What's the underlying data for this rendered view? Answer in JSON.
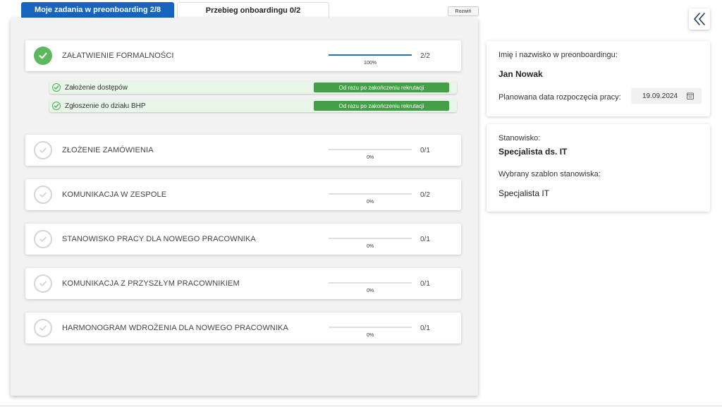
{
  "tabs": [
    {
      "label": "Moje zadania w preonboarding 2/8",
      "active": true
    },
    {
      "label": "Przebieg onboardingu 0/2",
      "active": false
    }
  ],
  "expand_label": "Rozwiń",
  "stages": [
    {
      "title": "ZAŁATWIENIE FORMALNOŚCI",
      "progress_pct": "100%",
      "progress": 1.0,
      "count": "2/2",
      "done": true
    },
    {
      "title": "ZŁOŻENIE ZAMÓWIENIA",
      "progress_pct": "0%",
      "progress": 0,
      "count": "0/1",
      "done": false
    },
    {
      "title": "KOMUNIKACJA W ZESPOLE",
      "progress_pct": "0%",
      "progress": 0,
      "count": "0/2",
      "done": false
    },
    {
      "title": "STANOWISKO PRACY DLA NOWEGO PRACOWNIKA",
      "progress_pct": "0%",
      "progress": 0,
      "count": "0/1",
      "done": false
    },
    {
      "title": "KOMUNIKACJA Z PRZYSZŁYM PRACOWNIKIEM",
      "progress_pct": "0%",
      "progress": 0,
      "count": "0/1",
      "done": false
    },
    {
      "title": "HARMONOGRAM WDROŻENIA DLA NOWEGO PRACOWNIKA",
      "progress_pct": "0%",
      "progress": 0,
      "count": "0/1",
      "done": false
    }
  ],
  "subtasks": [
    {
      "label": "Założenie dostępów",
      "badge": "Od razu po zakończeniu rekrutacji"
    },
    {
      "label": "Zgłoszenie do działu BHP",
      "badge": "Od razu po zakończeniu rekrutacji"
    }
  ],
  "person": {
    "name_label": "Imię i nazwisko w preonboardingu:",
    "name": "Jan Nowak",
    "date_label": "Planowana data rozpoczęcia pracy:",
    "date": "19.09.2024"
  },
  "position": {
    "label": "Stanowisko:",
    "value": "Specjalista ds. IT",
    "template_label": "Wybrany szablon stanowiska:",
    "template_value": "Specjalista IT"
  },
  "colors": {
    "accent": "#1565c0",
    "done_green": "#5cb85c",
    "badge_green": "#43a047",
    "progress_blue": "#2f6fb0"
  },
  "icons": {
    "collapse": "double-chevron-left-icon",
    "calendar": "calendar-icon",
    "check": "check-circle-icon"
  }
}
